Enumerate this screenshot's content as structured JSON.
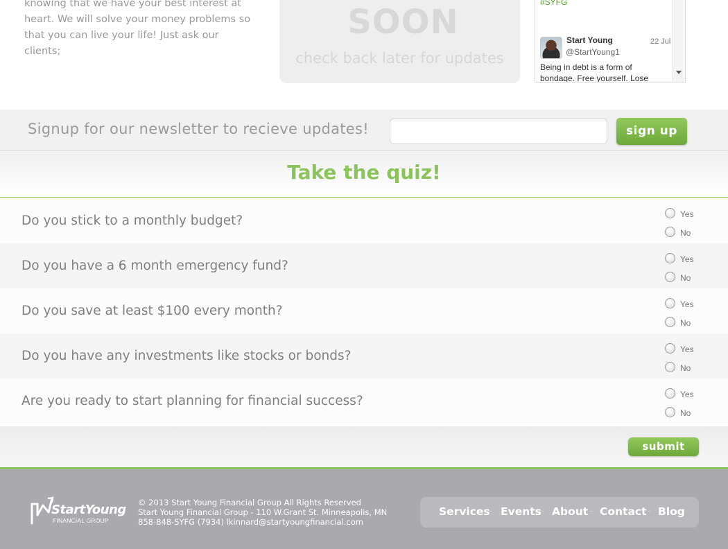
{
  "intro": {
    "lines": [
      "knowing that we have your best interest at",
      "heart. We will solve your money problems so",
      "that you can live your life! Just ask our clients;"
    ]
  },
  "coming_soon": {
    "word": "SOON",
    "subtitle": "check back later for updates"
  },
  "twitter": {
    "hashtag": "#SYFG",
    "name": "Start Young",
    "handle": "@StartYoung1",
    "date": "22 Jul",
    "text": "Being in debt is a form of bondage. Free yourself. Lose"
  },
  "newsletter": {
    "label": "Signup for our newsletter to recieve updates!",
    "input_value": "",
    "button": "sign up"
  },
  "quiz": {
    "title": "Take the quiz!",
    "questions": [
      {
        "text": "Do you stick to a monthly budget?",
        "yes": "Yes",
        "no": "No"
      },
      {
        "text": "Do you have a 6 month emergency fund?",
        "yes": "Yes",
        "no": "No"
      },
      {
        "text": "Do you save at least $100 every month?",
        "yes": "Yes",
        "no": "No"
      },
      {
        "text": "Do you have any investments like stocks or bonds?",
        "yes": "Yes",
        "no": "No"
      },
      {
        "text": "Are you ready to start planning for financial success?",
        "yes": "Yes",
        "no": "No"
      }
    ],
    "submit": "submit"
  },
  "footer": {
    "logo_word": "StartYoung",
    "logo_sub": "FINANCIAL GROUP",
    "copyright": "© 2013 Start Young Financial Group All Rights Reserved",
    "address": "Start Young Financial Group - 110 W.Grant St. Minneapolis, MN",
    "contact": "858-848-SYFG (7934) lkinnard@startyoungfinancial.com",
    "nav": [
      "Services",
      "Events",
      "About",
      "Contact",
      "Blog"
    ],
    "separator": "-"
  },
  "colors": {
    "accent_green": "#8cc35c",
    "footer_gray": "#a9a9ae"
  }
}
